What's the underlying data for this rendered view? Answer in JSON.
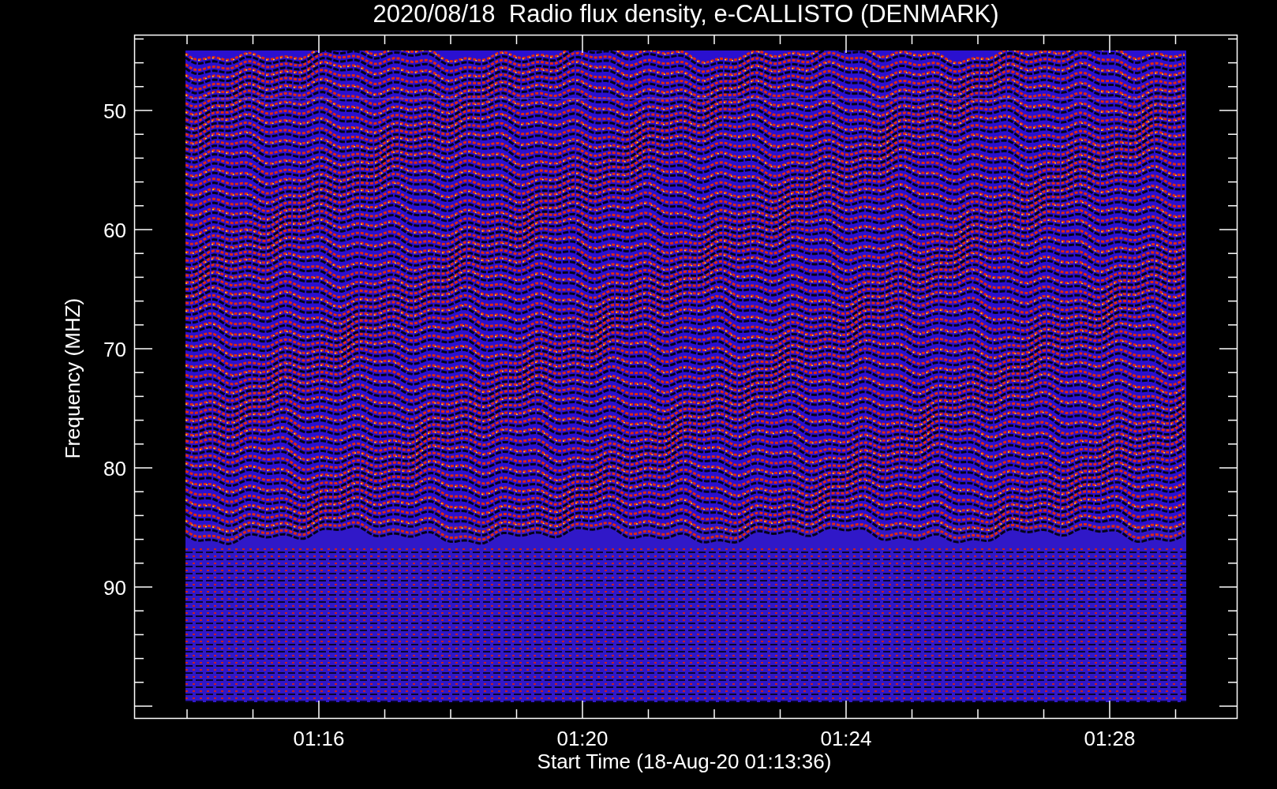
{
  "plot": {
    "title": "2020/08/18  Radio flux density, e-CALLISTO (DENMARK)",
    "ylabel": "Frequency (MHZ)",
    "xlabel": "Start Time (18-Aug-20 01:13:36)",
    "y_tick_labels": [
      "50",
      "60",
      "70",
      "80",
      "90"
    ],
    "x_tick_labels": [
      "01:16",
      "01:20",
      "01:24",
      "01:28"
    ]
  }
}
